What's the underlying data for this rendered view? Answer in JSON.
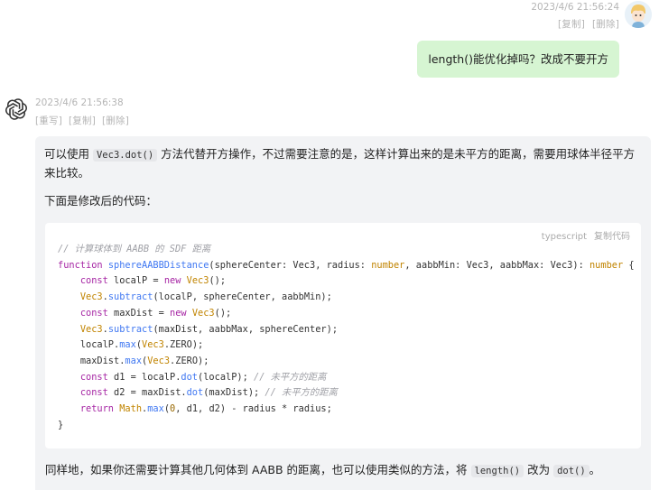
{
  "user_message": {
    "timestamp": "2023/4/6 21:56:24",
    "actions": [
      "[复制]",
      "[删除]"
    ],
    "text": "length()能优化掉吗？改成不要开方"
  },
  "bot_message": {
    "timestamp": "2023/4/6 21:56:38",
    "actions": [
      "[重写]",
      "[复制]",
      "[删除]"
    ],
    "para1_a": "可以使用 ",
    "para1_code": "Vec3.dot()",
    "para1_b": " 方法代替开方操作，不过需要注意的是，这样计算出来的是未平方的距离，需要用球体半径平方来比较。",
    "para2": "下面是修改后的代码：",
    "code_lang": "typescript",
    "code_copy": "复制代码",
    "para3_a": "同样地，如果你还需要计算其他几何体到 AABB 的距离，也可以使用类似的方法，将 ",
    "para3_code1": "length()",
    "para3_b": " 改为 ",
    "para3_code2": "dot()",
    "para3_c": "。"
  },
  "code": {
    "l1": "// 计算球体到 AABB 的 SDF 距离",
    "l2_kw": "function",
    "l2_fn": "sphereAABBDistance",
    "l2_a": "(sphereCenter: Vec3, radius: ",
    "l2_num": "number",
    "l2_b": ", aabbMin: Vec3, aabbMax: Vec3): ",
    "l2_num2": "number",
    "l2_c": " {",
    "l3_kw": "const",
    "l3_a": " localP = ",
    "l3_new": "new",
    "l3_ty": "Vec3",
    "l3_b": "();",
    "l4_ty": "Vec3",
    "l4_fn": "subtract",
    "l4_a": "(localP, sphereCenter, aabbMin);",
    "l5_kw": "const",
    "l5_a": " maxDist = ",
    "l5_new": "new",
    "l5_ty": "Vec3",
    "l5_b": "();",
    "l6_ty": "Vec3",
    "l6_fn": "subtract",
    "l6_a": "(maxDist, aabbMax, sphereCenter);",
    "l7_a": "localP.",
    "l7_fn": "max",
    "l7_ty": "Vec3",
    "l7_b": ".ZERO);",
    "l8_a": "maxDist.",
    "l8_fn": "max",
    "l8_ty": "Vec3",
    "l8_b": ".ZERO);",
    "l9_kw": "const",
    "l9_a": " d1 = localP.",
    "l9_fn": "dot",
    "l9_b": "(localP); ",
    "l9_cm": "// 未平方的距离",
    "l10_kw": "const",
    "l10_a": " d2 = maxDist.",
    "l10_fn": "dot",
    "l10_b": "(maxDist); ",
    "l10_cm": "// 未平方的距离",
    "l11_kw": "return",
    "l11_ty": "Math",
    "l11_fn": "max",
    "l11_a": "(",
    "l11_num": "0",
    "l11_b": ", d1, d2) - radius * radius;",
    "l12": "}"
  }
}
